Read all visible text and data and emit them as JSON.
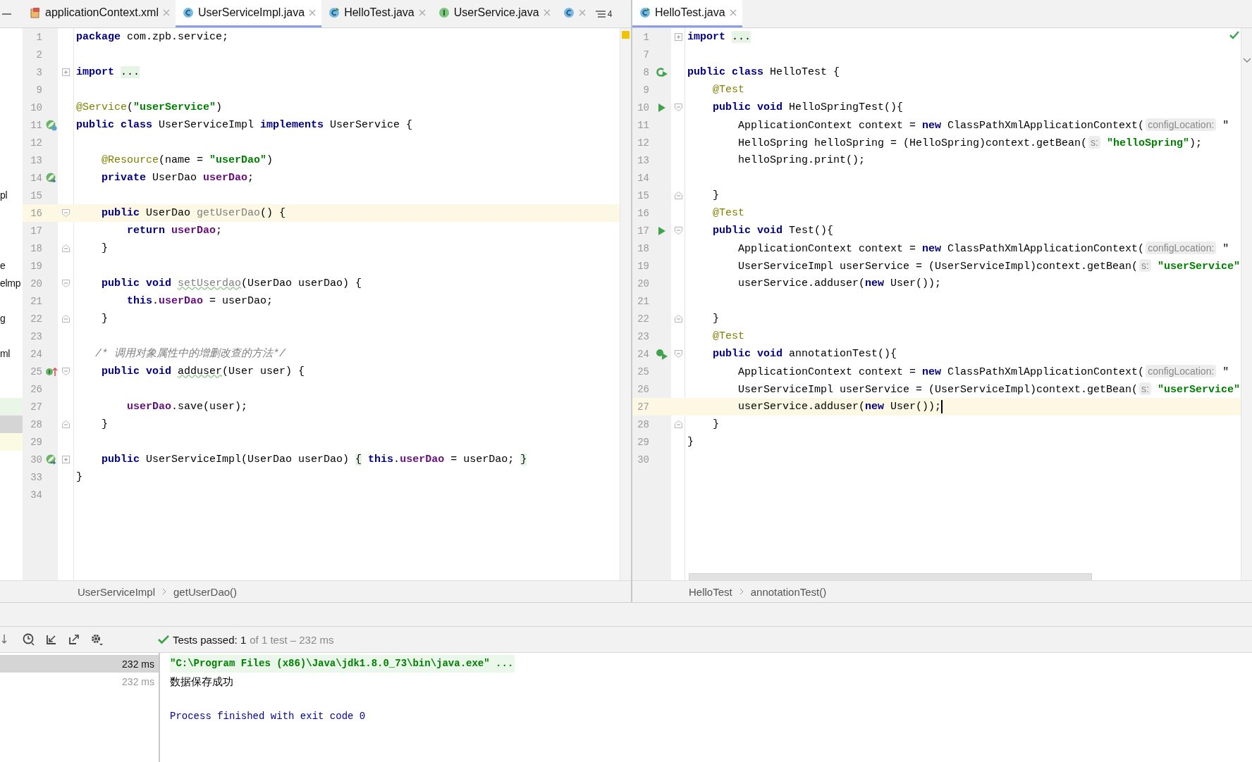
{
  "left_editor": {
    "tabs": [
      {
        "label": "applicationContext.xml",
        "kind": "xml",
        "selected": false
      },
      {
        "label": "UserServiceImpl.java",
        "kind": "class",
        "selected": true
      },
      {
        "label": "HelloTest.java",
        "kind": "test_class",
        "selected": false
      },
      {
        "label": "UserService.java",
        "kind": "interface",
        "selected": false
      }
    ],
    "overflow_tab": {
      "kind": "class"
    },
    "hidden_tabs_count": "4",
    "focused": false,
    "lines": [
      {
        "number": "1",
        "current": false,
        "tokens": [
          {
            "kind": "kw",
            "text": "package"
          },
          {
            "kind": "plain",
            "text": " com.zpb.service;"
          }
        ]
      },
      {
        "number": "2",
        "current": false
      },
      {
        "number": "3",
        "current": false,
        "fold": {
          "kind": "collapsed"
        },
        "tokens": [
          {
            "kind": "kw",
            "text": "import "
          },
          {
            "kind": "folded",
            "text": "..."
          }
        ]
      },
      {
        "number": "9",
        "current": false
      },
      {
        "number": "10",
        "current": false,
        "tokens": [
          {
            "kind": "ann",
            "text": "@Service"
          },
          {
            "kind": "plain",
            "text": "("
          },
          {
            "kind": "str",
            "text": "\"userService\""
          },
          {
            "kind": "plain",
            "text": ")"
          }
        ]
      },
      {
        "number": "11",
        "current": false,
        "gutter": {
          "kind": "bean"
        },
        "tokens": [
          {
            "kind": "kw",
            "text": "public class"
          },
          {
            "kind": "plain",
            "text": " UserServiceImpl "
          },
          {
            "kind": "kw",
            "text": "implements"
          },
          {
            "kind": "plain",
            "text": " UserService {"
          }
        ]
      },
      {
        "number": "12",
        "current": false
      },
      {
        "number": "13",
        "current": false,
        "tokens": [
          {
            "kind": "ann",
            "text": "    @Resource"
          },
          {
            "kind": "plain",
            "text": "(name = "
          },
          {
            "kind": "str",
            "text": "\"userDao\""
          },
          {
            "kind": "plain",
            "text": ")"
          }
        ]
      },
      {
        "number": "14",
        "current": false,
        "gutter": {
          "kind": "bean_link"
        },
        "tokens": [
          {
            "kind": "kw",
            "text": "    private"
          },
          {
            "kind": "plain",
            "text": " UserDao "
          },
          {
            "kind": "field",
            "text": "userDao"
          },
          {
            "kind": "plain",
            "text": ";"
          }
        ]
      },
      {
        "number": "15",
        "current": false,
        "tree": "pl"
      },
      {
        "number": "16",
        "current": true,
        "fold": {
          "kind": "open"
        },
        "tokens": [
          {
            "kind": "kw",
            "text": "    public"
          },
          {
            "kind": "plain",
            "text": " UserDao "
          },
          {
            "kind": "unused",
            "text": "getUserDao"
          },
          {
            "kind": "plain",
            "text": "() {"
          }
        ]
      },
      {
        "number": "17",
        "current": false,
        "tokens": [
          {
            "kind": "kw",
            "text": "        return "
          },
          {
            "kind": "field",
            "text": "userDao"
          },
          {
            "kind": "plain",
            "text": ";"
          }
        ]
      },
      {
        "number": "18",
        "current": false,
        "fold": {
          "kind": "close"
        },
        "tokens": [
          {
            "kind": "plain",
            "text": "    }"
          }
        ]
      },
      {
        "number": "19",
        "current": false,
        "tree": "e"
      },
      {
        "number": "20",
        "current": false,
        "fold": {
          "kind": "open"
        },
        "tree": "elmp",
        "tokens": [
          {
            "kind": "kw",
            "text": "    public void "
          },
          {
            "kind": "unused_typo",
            "text": "setUserdao"
          },
          {
            "kind": "plain",
            "text": "(UserDao userDao) {"
          }
        ]
      },
      {
        "number": "21",
        "current": false,
        "tokens": [
          {
            "kind": "kw",
            "text": "        this"
          },
          {
            "kind": "plain",
            "text": "."
          },
          {
            "kind": "field",
            "text": "userDao"
          },
          {
            "kind": "plain",
            "text": " = userDao;"
          }
        ]
      },
      {
        "number": "22",
        "current": false,
        "fold": {
          "kind": "close"
        },
        "tree": "g",
        "tokens": [
          {
            "kind": "plain",
            "text": "    }"
          }
        ]
      },
      {
        "number": "23",
        "current": false
      },
      {
        "number": "24",
        "current": false,
        "tree": "ml",
        "tokens": [
          {
            "kind": "comment",
            "text": "   /* 调用对象属性中的增删改查的方法*/"
          }
        ]
      },
      {
        "number": "25",
        "current": false,
        "gutter": {
          "kind": "implements"
        },
        "fold": {
          "kind": "open"
        },
        "tokens": [
          {
            "kind": "kw",
            "text": "    public void "
          },
          {
            "kind": "typo",
            "text": "adduser"
          },
          {
            "kind": "plain",
            "text": "(User user) {"
          }
        ]
      },
      {
        "number": "26",
        "current": false
      },
      {
        "number": "27",
        "current": false,
        "tree_row": {
          "kind": "added"
        },
        "tokens": [
          {
            "kind": "field",
            "text": "        userDao"
          },
          {
            "kind": "plain",
            "text": ".save(user);"
          }
        ]
      },
      {
        "number": "28",
        "current": false,
        "fold": {
          "kind": "close"
        },
        "tree_row": {
          "kind": "selected"
        },
        "tokens": [
          {
            "kind": "plain",
            "text": "    }"
          }
        ]
      },
      {
        "number": "29",
        "current": false,
        "tree_row": {
          "kind": "changed"
        }
      },
      {
        "number": "30",
        "current": false,
        "gutter": {
          "kind": "bean_link"
        },
        "fold": {
          "kind": "collapsed"
        },
        "tokens": [
          {
            "kind": "kw",
            "text": "    public"
          },
          {
            "kind": "plain",
            "text": " UserServiceImpl(UserDao userDao) "
          },
          {
            "kind": "folded",
            "text": "{"
          },
          {
            "kind": "kw",
            "text": " this"
          },
          {
            "kind": "plain",
            "text": "."
          },
          {
            "kind": "field",
            "text": "userDao"
          },
          {
            "kind": "plain",
            "text": " = userDao; "
          },
          {
            "kind": "folded",
            "text": "}"
          }
        ]
      },
      {
        "number": "33",
        "current": false,
        "tokens": [
          {
            "kind": "plain",
            "text": "}"
          }
        ]
      },
      {
        "number": "34",
        "current": false
      }
    ],
    "breadcrumb": [
      "UserServiceImpl",
      "getUserDao()"
    ]
  },
  "right_editor": {
    "tabs": [
      {
        "label": "HelloTest.java",
        "kind": "test_class",
        "selected": true
      }
    ],
    "focused": true,
    "lines": [
      {
        "number": "1",
        "current": false,
        "fold": {
          "kind": "collapsed"
        },
        "tokens": [
          {
            "kind": "kw",
            "text": "import "
          },
          {
            "kind": "folded",
            "text": "..."
          }
        ]
      },
      {
        "number": "7",
        "current": false
      },
      {
        "number": "8",
        "current": false,
        "gutter": {
          "kind": "run_all"
        },
        "tokens": [
          {
            "kind": "kw",
            "text": "public class"
          },
          {
            "kind": "plain",
            "text": " HelloTest {"
          }
        ]
      },
      {
        "number": "9",
        "current": false,
        "tokens": [
          {
            "kind": "ann",
            "text": "    @Test"
          }
        ]
      },
      {
        "number": "10",
        "current": false,
        "gutter": {
          "kind": "run"
        },
        "fold": {
          "kind": "open"
        },
        "tokens": [
          {
            "kind": "kw",
            "text": "    public void"
          },
          {
            "kind": "plain",
            "text": " HelloSpringTest(){"
          }
        ]
      },
      {
        "number": "11",
        "current": false,
        "tokens": [
          {
            "kind": "plain",
            "text": "        ApplicationContext context = "
          },
          {
            "kind": "kw",
            "text": "new"
          },
          {
            "kind": "plain",
            "text": " ClassPathXmlApplicationContext("
          },
          {
            "kind": "hint",
            "text": "configLocation:"
          },
          {
            "kind": "plain",
            "text": " \""
          }
        ]
      },
      {
        "number": "12",
        "current": false,
        "tokens": [
          {
            "kind": "plain",
            "text": "        HelloSpring helloSpring = (HelloSpring)context.getBean("
          },
          {
            "kind": "hint",
            "text": "s:"
          },
          {
            "kind": "str",
            "text": " \"helloSpring\""
          },
          {
            "kind": "plain",
            "text": ");"
          }
        ]
      },
      {
        "number": "13",
        "current": false,
        "tokens": [
          {
            "kind": "plain",
            "text": "        helloSpring.print();"
          }
        ]
      },
      {
        "number": "14",
        "current": false
      },
      {
        "number": "15",
        "current": false,
        "fold": {
          "kind": "close"
        },
        "tokens": [
          {
            "kind": "plain",
            "text": "    }"
          }
        ]
      },
      {
        "number": "16",
        "current": false,
        "tokens": [
          {
            "kind": "ann",
            "text": "    @Test"
          }
        ]
      },
      {
        "number": "17",
        "current": false,
        "gutter": {
          "kind": "run"
        },
        "fold": {
          "kind": "open"
        },
        "tokens": [
          {
            "kind": "kw",
            "text": "    public void"
          },
          {
            "kind": "plain",
            "text": " Test(){"
          }
        ]
      },
      {
        "number": "18",
        "current": false,
        "tokens": [
          {
            "kind": "plain",
            "text": "        ApplicationContext context = "
          },
          {
            "kind": "kw",
            "text": "new"
          },
          {
            "kind": "plain",
            "text": " ClassPathXmlApplicationContext("
          },
          {
            "kind": "hint",
            "text": "configLocation:"
          },
          {
            "kind": "plain",
            "text": " \""
          }
        ]
      },
      {
        "number": "19",
        "current": false,
        "tokens": [
          {
            "kind": "plain",
            "text": "        UserServiceImpl userService = (UserServiceImpl)context.getBean("
          },
          {
            "kind": "hint",
            "text": "s:"
          },
          {
            "kind": "str",
            "text": " \"userService\""
          }
        ]
      },
      {
        "number": "20",
        "current": false,
        "tokens": [
          {
            "kind": "plain",
            "text": "        userService.adduser("
          },
          {
            "kind": "kw",
            "text": "new"
          },
          {
            "kind": "plain",
            "text": " User());"
          }
        ]
      },
      {
        "number": "21",
        "current": false
      },
      {
        "number": "22",
        "current": false,
        "fold": {
          "kind": "close"
        },
        "tokens": [
          {
            "kind": "plain",
            "text": "    }"
          }
        ]
      },
      {
        "number": "23",
        "current": false,
        "tokens": [
          {
            "kind": "ann",
            "text": "    @Test"
          }
        ]
      },
      {
        "number": "24",
        "current": false,
        "gutter": {
          "kind": "run_ok"
        },
        "fold": {
          "kind": "open"
        },
        "tokens": [
          {
            "kind": "kw",
            "text": "    public void"
          },
          {
            "kind": "plain",
            "text": " annotationTest(){"
          }
        ]
      },
      {
        "number": "25",
        "current": false,
        "tokens": [
          {
            "kind": "plain",
            "text": "        ApplicationContext context = "
          },
          {
            "kind": "kw",
            "text": "new"
          },
          {
            "kind": "plain",
            "text": " ClassPathXmlApplicationContext("
          },
          {
            "kind": "hint",
            "text": "configLocation:"
          },
          {
            "kind": "plain",
            "text": " \""
          }
        ]
      },
      {
        "number": "26",
        "current": false,
        "tokens": [
          {
            "kind": "plain",
            "text": "        UserServiceImpl userService = (UserServiceImpl)context.getBean("
          },
          {
            "kind": "hint",
            "text": "s:"
          },
          {
            "kind": "str",
            "text": " \"userService\""
          }
        ]
      },
      {
        "number": "27",
        "current": true,
        "tokens": [
          {
            "kind": "plain",
            "text": "        userService.adduser("
          },
          {
            "kind": "kw",
            "text": "new"
          },
          {
            "kind": "plain",
            "text": " User());"
          }
        ]
      },
      {
        "number": "28",
        "current": false,
        "fold": {
          "kind": "close"
        },
        "tokens": [
          {
            "kind": "plain",
            "text": "    }"
          }
        ]
      },
      {
        "number": "29",
        "current": false,
        "tokens": [
          {
            "kind": "plain",
            "text": "}"
          }
        ]
      },
      {
        "number": "30",
        "current": false
      }
    ],
    "breadcrumb": [
      "HelloTest",
      "annotationTest()"
    ]
  },
  "run_panel": {
    "status": "Tests passed: 1",
    "status_detail": "of 1 test – 232 ms",
    "tests": [
      {
        "time": "232 ms",
        "selected": true
      },
      {
        "time": "232 ms",
        "selected": false
      }
    ],
    "output": [
      {
        "kind": "command",
        "text": "\"C:\\Program Files (x86)\\Java\\jdk1.8.0_73\\bin\\java.exe\" ..."
      },
      {
        "kind": "stdout",
        "text": "数据保存成功"
      },
      {
        "kind": "system",
        "text": "Process finished with exit code 0"
      }
    ]
  }
}
